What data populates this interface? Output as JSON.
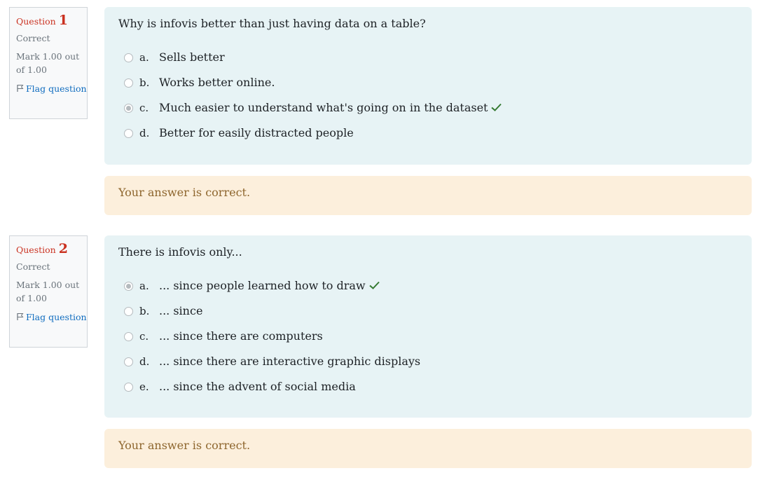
{
  "questions": [
    {
      "label": "Question",
      "number": "1",
      "state": "Correct",
      "grade": "Mark 1.00 out of 1.00",
      "flag_label": "Flag question",
      "text": "Why is infovis better than just having data on a table?",
      "answers": [
        {
          "letter": "a.",
          "text": "Sells better",
          "selected": false,
          "correct": false
        },
        {
          "letter": "b.",
          "text": "Works better online.",
          "selected": false,
          "correct": false
        },
        {
          "letter": "c.",
          "text": "Much easier to understand what's going on in the dataset",
          "selected": true,
          "correct": true
        },
        {
          "letter": "d.",
          "text": "Better for easily distracted people",
          "selected": false,
          "correct": false
        }
      ],
      "feedback": "Your answer is correct."
    },
    {
      "label": "Question",
      "number": "2",
      "state": "Correct",
      "grade": "Mark 1.00 out of 1.00",
      "flag_label": "Flag question",
      "text": "There is infovis only...",
      "answers": [
        {
          "letter": "a.",
          "text": "... since people learned how to draw",
          "selected": true,
          "correct": true
        },
        {
          "letter": "b.",
          "text": "... since",
          "selected": false,
          "correct": false
        },
        {
          "letter": "c.",
          "text": "... since there are computers",
          "selected": false,
          "correct": false
        },
        {
          "letter": "d.",
          "text": "... since there are interactive graphic displays",
          "selected": false,
          "correct": false
        },
        {
          "letter": "e.",
          "text": "... since the advent of social media",
          "selected": false,
          "correct": false
        }
      ],
      "feedback": "Your answer is correct."
    }
  ],
  "colors": {
    "question_label": "#ca3120",
    "link": "#0f6cbf",
    "check": "#357a32",
    "formulation_bg": "#e7f3f5",
    "feedback_bg": "#fcefdc",
    "feedback_text": "#8e662e"
  },
  "icons": {
    "flag": "flag-icon",
    "correct": "check-icon"
  }
}
